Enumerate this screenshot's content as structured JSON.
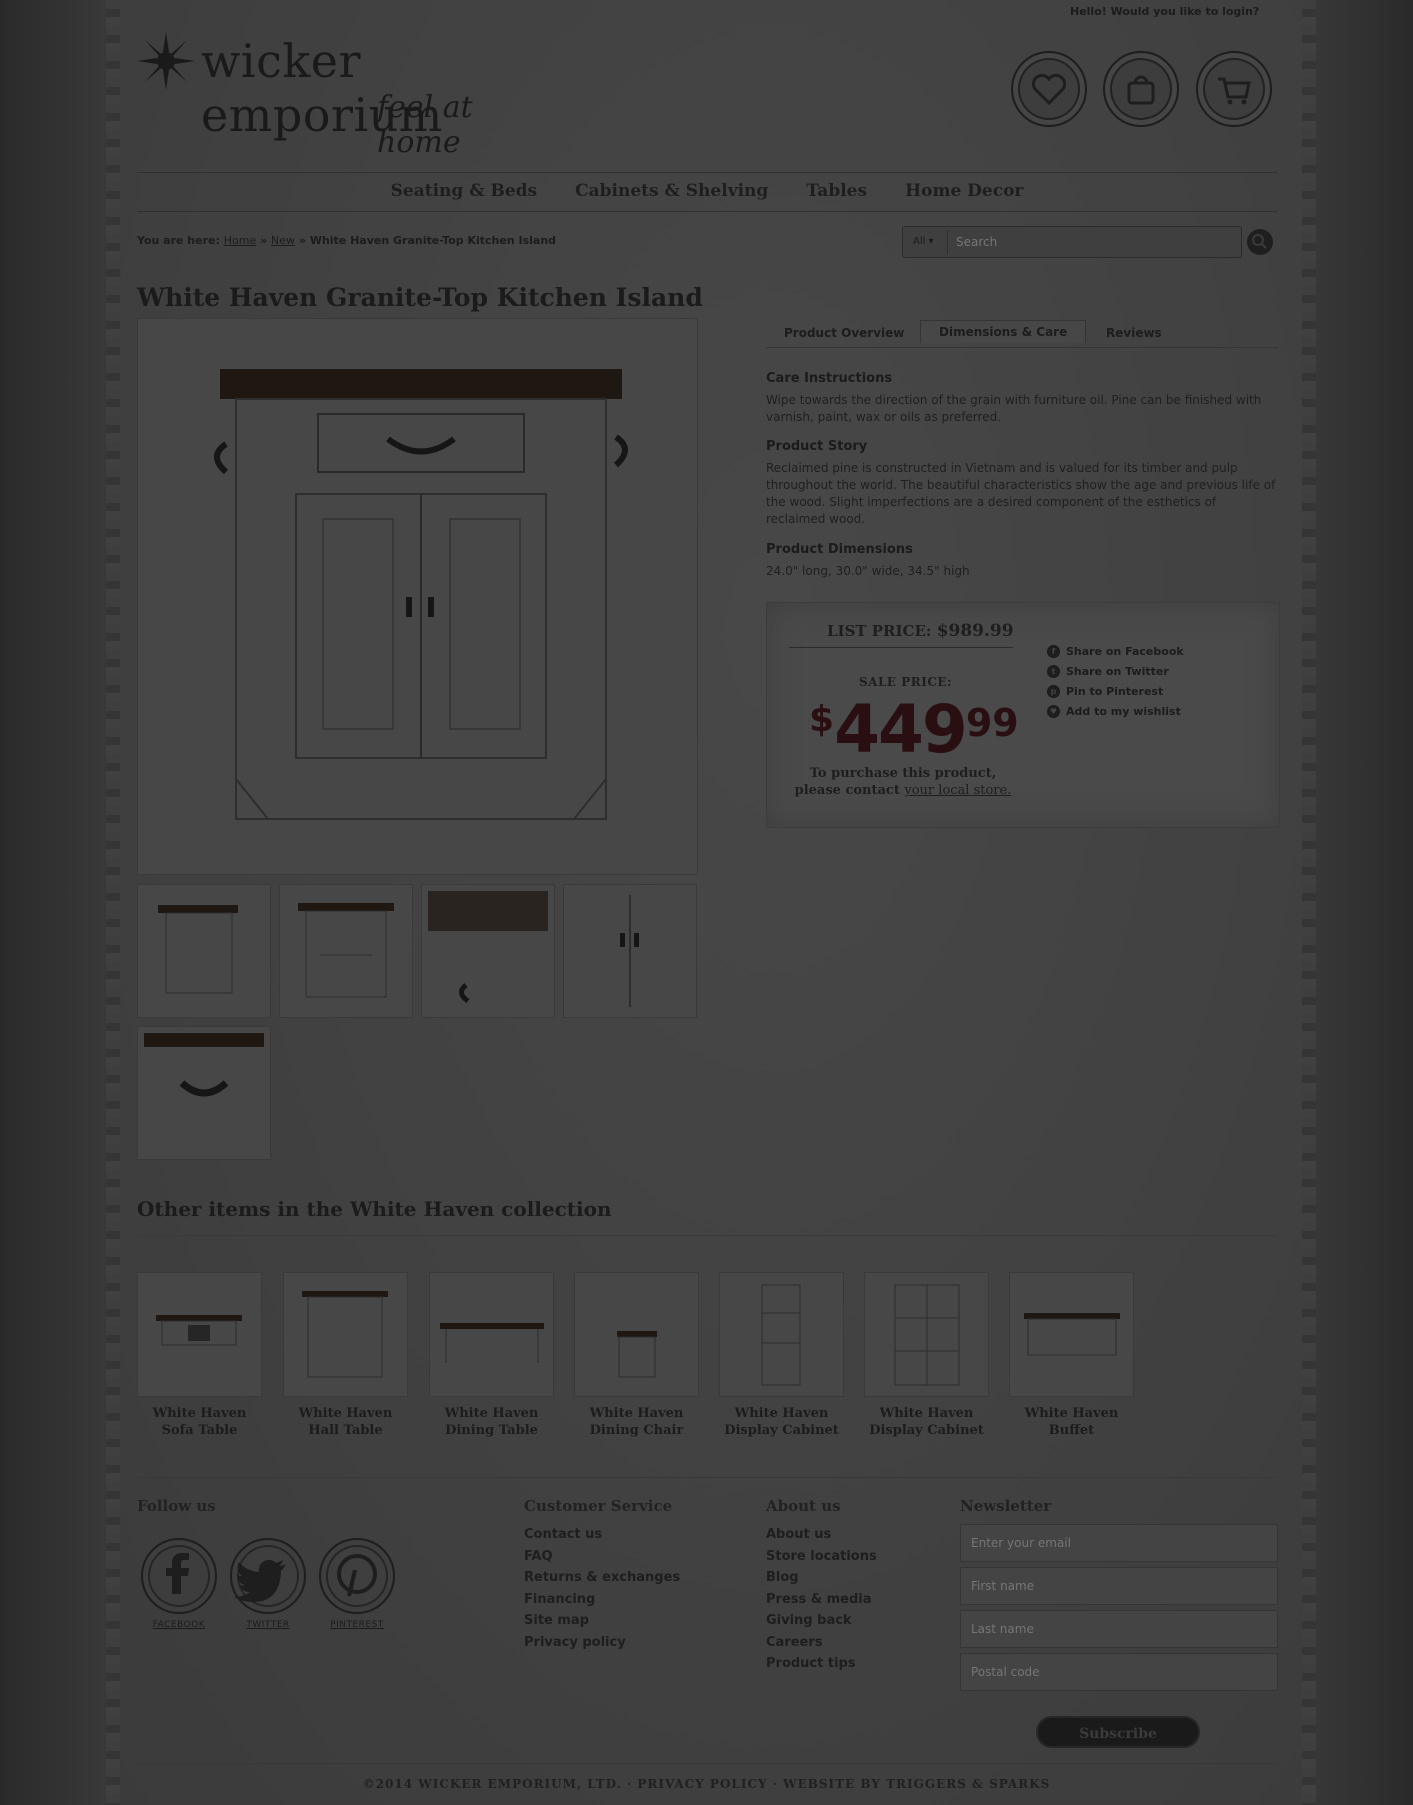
{
  "header": {
    "login_prompt": "Hello! Would you like to login?",
    "logo_name": "wicker emporium",
    "logo_tagline": "feel at home"
  },
  "nav": {
    "items": [
      "Seating & Beds",
      "Cabinets & Shelving",
      "Tables",
      "Home Decor"
    ]
  },
  "breadcrumb": {
    "prefix": "You are here:",
    "home": "Home",
    "sep": "»",
    "section": "New",
    "current": "White Haven Granite-Top Kitchen Island"
  },
  "search": {
    "scope": "All",
    "placeholder": "Search"
  },
  "product": {
    "title": "White Haven Granite-Top Kitchen Island",
    "tabs": [
      "Product Overview",
      "Dimensions & Care",
      "Reviews"
    ],
    "active_tab": "Dimensions & Care",
    "care_heading": "Care Instructions",
    "care_text": "Wipe towards the direction of the grain with furniture oil. Pine can be finished with varnish, paint, wax or oils as preferred.",
    "story_heading": "Product Story",
    "story_text": "Reclaimed pine is constructed in Vietnam and is valued for its timber and pulp throughout the world. The beautiful characteristics show the age and previous life of the wood. Slight imperfections are a desired component of the esthetics of reclaimed wood.",
    "dims_heading": "Product Dimensions",
    "dims_text": "24.0\" long, 30.0\" wide, 34.5\" high"
  },
  "pricing": {
    "list_label": "LIST PRICE:",
    "list_value": "$989.99",
    "sale_label": "SALE PRICE:",
    "sale_currency": "$",
    "sale_dollars": "449",
    "sale_cents": "99",
    "note_line1": "To purchase this product,",
    "note_line2": "please contact",
    "note_link": "your local store."
  },
  "share": [
    "Share on Facebook",
    "Share on Twitter",
    "Pin to Pinterest",
    "Add to my wishlist"
  ],
  "collection": {
    "title": "Other items in the White Haven collection",
    "items": [
      {
        "line1": "White Haven",
        "line2": "Sofa Table"
      },
      {
        "line1": "White Haven",
        "line2": "Hall Table"
      },
      {
        "line1": "White Haven",
        "line2": "Dining Table"
      },
      {
        "line1": "White Haven",
        "line2": "Dining Chair"
      },
      {
        "line1": "White Haven",
        "line2": "Display Cabinet"
      },
      {
        "line1": "White Haven",
        "line2": "Display Cabinet"
      },
      {
        "line1": "White Haven",
        "line2": "Buffet"
      }
    ]
  },
  "footer": {
    "follow_heading": "Follow us",
    "social": [
      "FACEBOOK",
      "TWITTER",
      "PINTEREST"
    ],
    "cs_heading": "Customer Service",
    "cs_links": [
      "Contact us",
      "FAQ",
      "Returns & exchanges",
      "Financing",
      "Site map",
      "Privacy policy"
    ],
    "about_heading": "About us",
    "about_links": [
      "About us",
      "Store locations",
      "Blog",
      "Press & media",
      "Giving back",
      "Careers",
      "Product tips"
    ],
    "newsletter_heading": "Newsletter",
    "newsletter_fields": [
      "Enter your email",
      "First name",
      "Last name",
      "Postal code"
    ],
    "subscribe_label": "Subscribe",
    "copyright": "©2014 WICKER EMPORIUM, LTD. · PRIVACY POLICY · WEBSITE BY TRIGGERS & SPARKS"
  },
  "colors": {
    "overlay_bg": "#2f2f2f",
    "paper": "#444444",
    "sale_price": "#2a0f12"
  }
}
